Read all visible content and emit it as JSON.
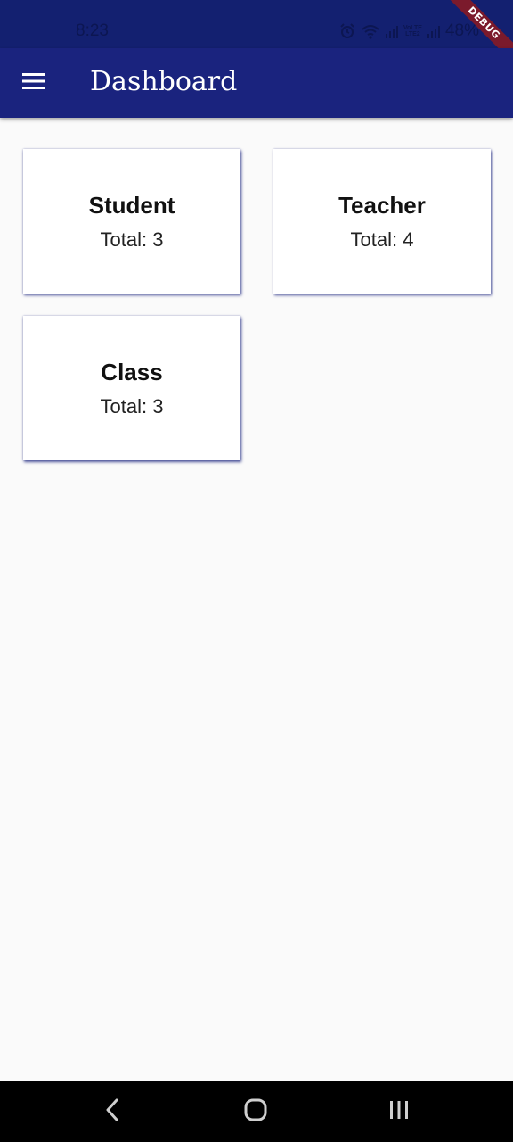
{
  "status_bar": {
    "time": "8:23",
    "battery": "48%",
    "volte_top": "VoLTE",
    "volte_bottom": "LTE2"
  },
  "debug_banner": "DEBUG",
  "app_bar": {
    "title": "Dashboard",
    "menu_icon": "hamburger-menu-icon",
    "background": "#1a237e"
  },
  "cards": [
    {
      "title": "Student",
      "total": "Total: 3"
    },
    {
      "title": "Teacher",
      "total": "Total: 4"
    },
    {
      "title": "Class",
      "total": "Total: 3"
    }
  ],
  "nav_bar": {
    "back_icon": "back-chevron-icon",
    "home_icon": "home-icon",
    "recent_icon": "recent-apps-icon"
  }
}
